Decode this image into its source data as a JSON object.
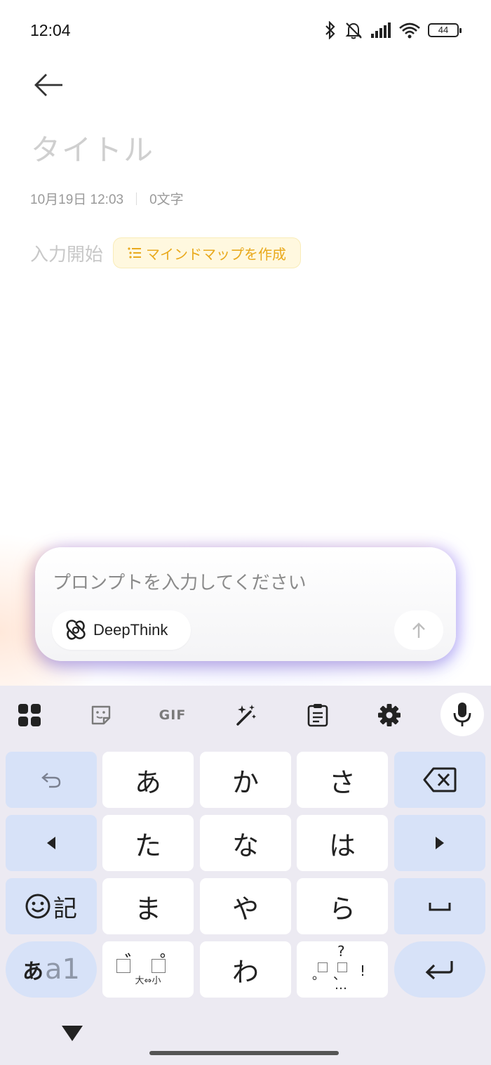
{
  "status_bar": {
    "time": "12:04",
    "battery_level": "44",
    "icons": [
      "bluetooth-icon",
      "bell-muted-icon",
      "signal-icon",
      "wifi-icon",
      "battery-icon"
    ]
  },
  "note": {
    "title_placeholder": "タイトル",
    "date": "10月19日 12:03",
    "char_count": "0文字",
    "body_placeholder": "入力開始",
    "mindmap_button": "マインドマップを作成"
  },
  "prompt": {
    "placeholder": "プロンプトを入力してください",
    "deepthink_label": "DeepThink"
  },
  "keyboard": {
    "toolbar": {
      "gif_label": "GIF",
      "icons": [
        "apps-grid-icon",
        "sticker-icon",
        "gif-icon",
        "magic-wand-icon",
        "clipboard-icon",
        "settings-gear-icon",
        "microphone-icon"
      ]
    },
    "rows": [
      [
        "あ",
        "か",
        "さ"
      ],
      [
        "た",
        "な",
        "は"
      ],
      [
        "ま",
        "や",
        "ら"
      ],
      [
        "゛゜",
        "わ",
        "、。?!"
      ]
    ],
    "kigo_label": "記",
    "mode_label_kana": "あ",
    "mode_label_alnum": "a1",
    "dakuten_sub": "大⇔小",
    "punct": {
      "question": "?",
      "period": "。",
      "comma": "、",
      "exclaim": "!",
      "ellipsis": "…"
    },
    "dakuten_marks": {
      "dakuten": "゛",
      "handakuten": "゜"
    }
  },
  "colors": {
    "accent_yellow": "#e9a91c",
    "key_fn": "#d7e2f8",
    "keyboard_bg": "#eceaf2"
  }
}
